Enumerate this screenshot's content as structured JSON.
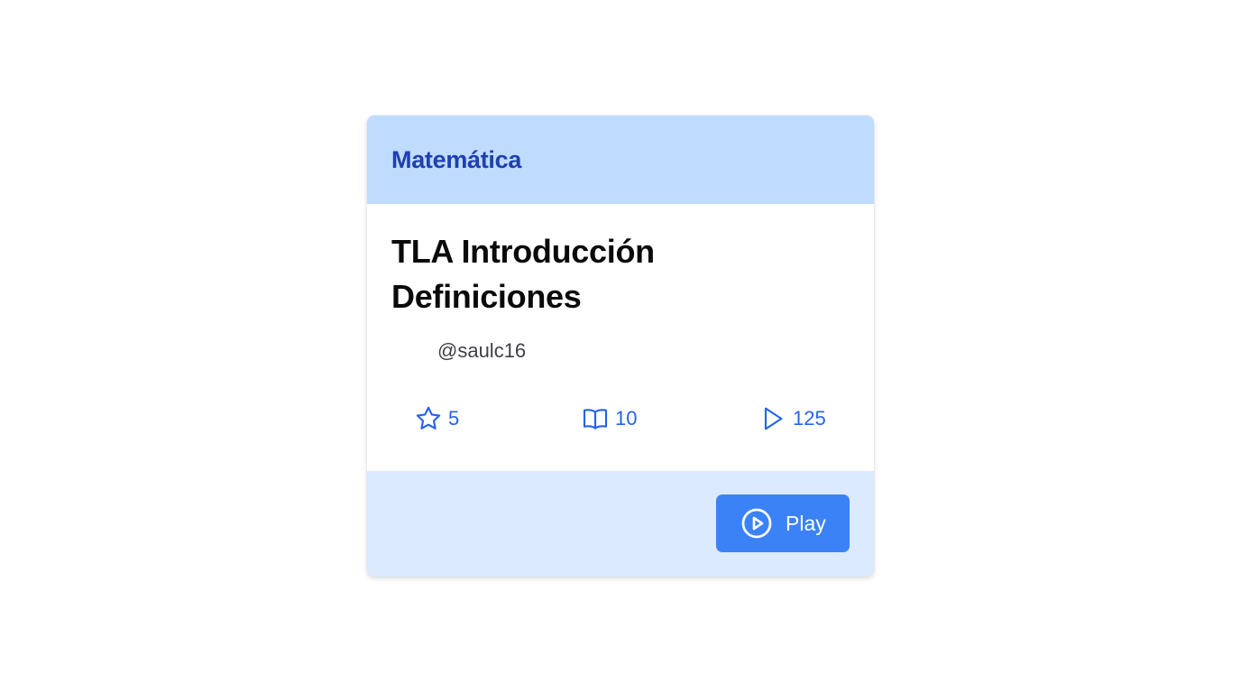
{
  "card": {
    "category": "Matemática",
    "title": "TLA Introducción Definiciones",
    "author": "@saulc16",
    "stats": {
      "stars": "5",
      "cards": "10",
      "plays": "125"
    },
    "play_button_label": "Play"
  },
  "icons": {
    "stars": "star-icon",
    "cards": "open-book-icon",
    "plays": "play-icon",
    "play_button": "play-circle-icon"
  },
  "colors": {
    "header_bg": "#bfdbfe",
    "category_text": "#1e40af",
    "footer_bg": "#dbeafe",
    "accent": "#2563eb",
    "button_bg": "#3b82f6"
  }
}
